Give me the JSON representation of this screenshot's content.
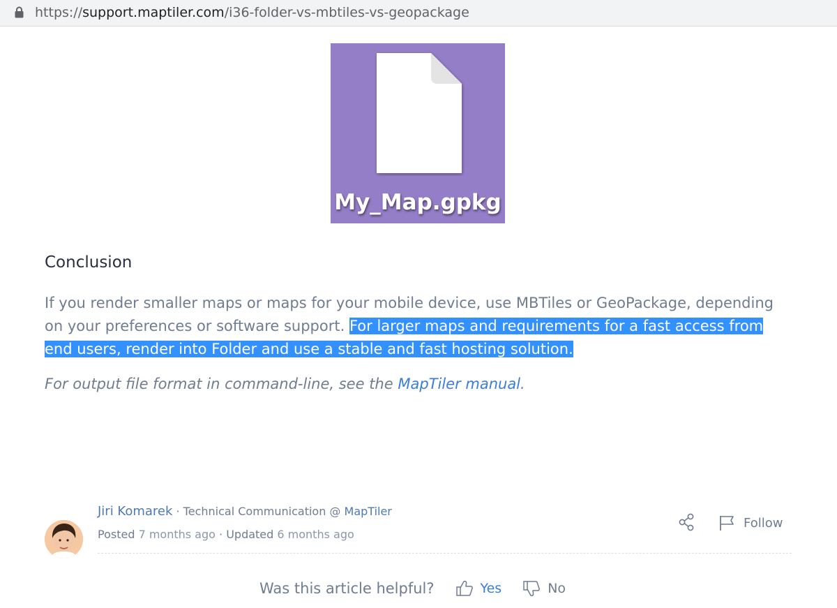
{
  "browser": {
    "url_scheme": "https://",
    "url_host": "support.maptiler.com",
    "url_path": "/i36-folder-vs-mbtiles-vs-geopackage"
  },
  "article": {
    "thumbnail": {
      "filename": "My_Map.gpkg",
      "background_color": "#957ec8",
      "icon": "file-icon"
    },
    "heading": "Conclusion",
    "paragraph_plain": "If you render smaller maps or maps for your mobile device, use MBTiles or GeoPackage, depending on your preferences or software support. ",
    "paragraph_selected": "For larger maps and requirements for a fast access from end users, render into Folder and use a stable and fast hosting solution.",
    "note_prefix": "For output file format in command-line, see the ",
    "note_link": "MapTiler manual",
    "note_suffix": "."
  },
  "author": {
    "name": "Jiri Komarek",
    "role_prefix": " · Technical Communication @ ",
    "organization": "MapTiler",
    "posted_label": "Posted ",
    "posted_time": "7 months ago",
    "updated_label": " · Updated ",
    "updated_time": "6 months ago"
  },
  "actions": {
    "share_icon": "share-icon",
    "follow_label": "Follow"
  },
  "feedback": {
    "question": "Was this article helpful?",
    "yes_label": "Yes",
    "no_label": "No"
  },
  "colors": {
    "selection_highlight": "#3390ff",
    "link": "#3b7ddd",
    "body_text": "#6f7c91"
  }
}
